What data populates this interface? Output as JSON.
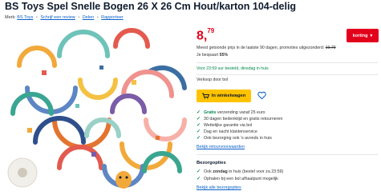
{
  "product": {
    "title": "BS Toys Spel Snelle Bogen 26 X 26 Cm Hout/karton 104-delig",
    "merk_label": "Merk:",
    "brand": "BS Toys",
    "review_link": "Schrijf een review",
    "share_link": "Delen",
    "report_link": "Rapporteer"
  },
  "pricing": {
    "price_whole": "8,",
    "price_cents": "79",
    "korting_label": "korting",
    "reference_text": "Meest getoonde prijs in de laatste 90 dagen, promoties uitgezonderd:",
    "reference_price": "19,79",
    "savings_label": "Je bespaart",
    "savings_value": "55%"
  },
  "delivery": {
    "text": "Voor 23:59 uur besteld, dinsdag in huis",
    "seller": "Verkoop door bol"
  },
  "actions": {
    "cart_label": "In winkelwagen"
  },
  "usps": [
    {
      "strong": "Gratis",
      "rest": " verzending vanaf 25 euro"
    },
    {
      "strong": "",
      "rest": "30 dagen bedenktijd en gratis retourneren"
    },
    {
      "strong": "",
      "rest": "Wettelijke garantie via bol"
    },
    {
      "strong": "",
      "rest": "Dag en nacht klantenservice"
    },
    {
      "strong": "",
      "rest": "Ook bezorging ook 's avonds in huis"
    }
  ],
  "links": {
    "return_conditions": "Bekijk retourvoorwaarden",
    "all_delivery_options": "Bekijk alle bezorgopties"
  },
  "bezorgopties": {
    "title": "Bezorgopties",
    "items": [
      {
        "pre": "Ook ",
        "strong": "zondag",
        "rest": " in huis (bestel voor za 23:59)"
      },
      {
        "pre": "",
        "strong": "",
        "rest": "Ophalen bij een bol afhaalpunt mogelijk"
      }
    ]
  },
  "colors": {
    "price_red": "#e3001b",
    "cart_yellow": "#ffc300",
    "success_green": "#00894c",
    "link_blue": "#0a60c8"
  }
}
